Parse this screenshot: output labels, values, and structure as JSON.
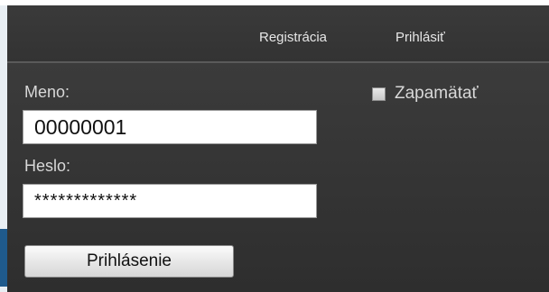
{
  "nav": {
    "register_label": "Registrácia",
    "login_label": "Prihlásiť"
  },
  "login_form": {
    "username_label": "Meno:",
    "username_value": "00000001",
    "password_label": "Heslo:",
    "password_value": "*************",
    "remember_label": "Zapamätať",
    "remember_checked": false,
    "submit_label": "Prihlásenie"
  },
  "colors": {
    "bar_background": "#363636",
    "panel_background": "#333333",
    "text_light": "#d8d8d8"
  }
}
